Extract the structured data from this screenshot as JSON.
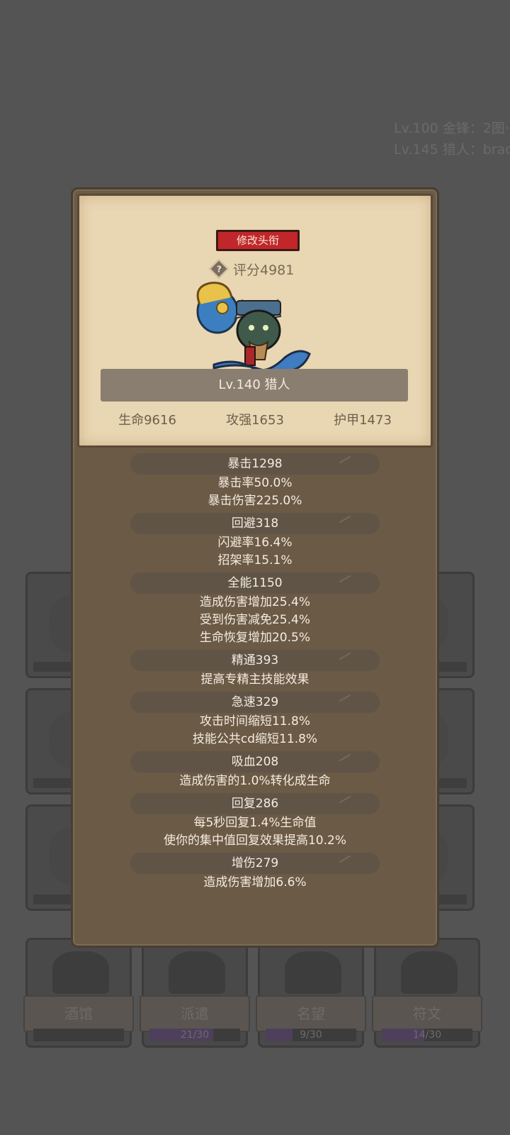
{
  "background": {
    "log_lines": [
      "Lv.100 金锋：2图·",
      "Lv.145 猎人：brac"
    ],
    "bottom_buttons": [
      {
        "label": "酒馆",
        "progress_text": "",
        "progress": 0.0
      },
      {
        "label": "派遣",
        "progress_text": "21/30",
        "progress": 0.7
      },
      {
        "label": "名望",
        "progress_text": "9/30",
        "progress": 0.3
      },
      {
        "label": "符文",
        "progress_text": "14/30",
        "progress": 0.47
      }
    ]
  },
  "popup": {
    "rename_button": "修改头衔",
    "score_label": "评分4981",
    "character_icon": "horned-hunter-avatar",
    "name_bar": "Lv.140 猎人",
    "stats": [
      "生命9616",
      "攻强1653",
      "护甲1473"
    ],
    "attribute_groups": [
      {
        "header": "暴击1298",
        "lines": [
          "暴击率50.0%",
          "暴击伤害225.0%"
        ]
      },
      {
        "header": "回避318",
        "lines": [
          "闪避率16.4%",
          "招架率15.1%"
        ]
      },
      {
        "header": "全能1150",
        "lines": [
          "造成伤害增加25.4%",
          "受到伤害减免25.4%",
          "生命恢复增加20.5%"
        ]
      },
      {
        "header": "精通393",
        "lines": [
          "提高专精主技能效果"
        ]
      },
      {
        "header": "急速329",
        "lines": [
          "攻击时间缩短11.8%",
          "技能公共cd缩短11.8%"
        ]
      },
      {
        "header": "吸血208",
        "lines": [
          "造成伤害的1.0%转化成生命"
        ]
      },
      {
        "header": "回复286",
        "lines": [
          "每5秒回复1.4%生命值",
          "使你的集中值回复效果提高10.2%"
        ]
      },
      {
        "header": "增伤279",
        "lines": [
          "造成伤害增加6.6%"
        ]
      }
    ]
  }
}
